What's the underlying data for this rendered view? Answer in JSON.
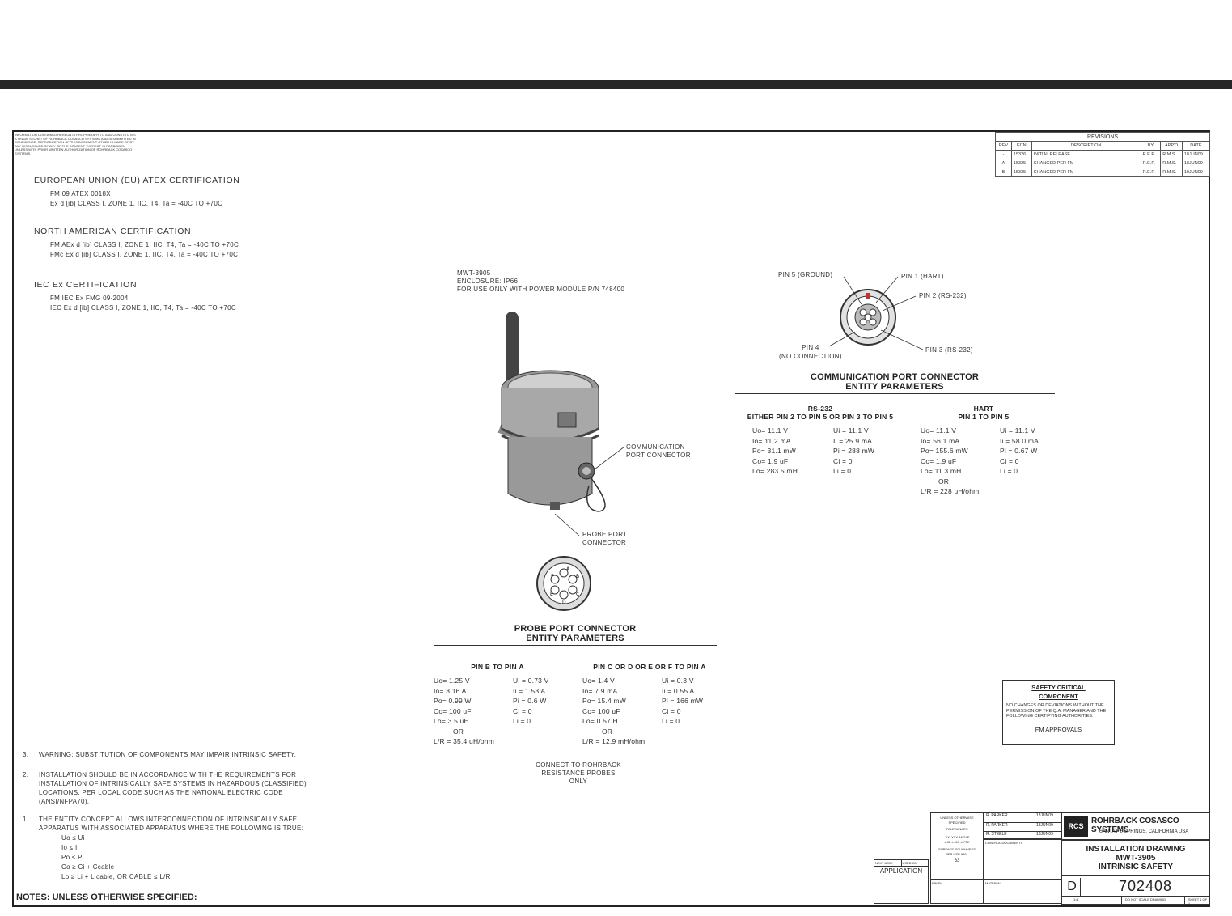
{
  "legal_text": "INFORMATION CONTAINED HEREON IS PROPRIETARY TO AND CONSTITUTES A TRADE SECRET OF ROHRBACK COSASCO SYSTEMS AND IS SUBMITTED IN CONFIDENCE. REPRODUCTION OF THIS DOCUMENT OTHER IS MADE OF BY ANY DISCLOSURE OF ANY OF THE CONTENT THEREOF IS FORBIDDEN UNLESS WITH PRIOR WRITTEN AUTHORIZATION OF ROHRBACK COSASCO SYSTEMS.",
  "certifications": [
    {
      "heading": "EUROPEAN UNION (EU) ATEX CERTIFICATION",
      "lines": [
        "FM 09 ATEX 0018X",
        "Ex d [ib] CLASS I, ZONE 1, IIC, T4, Ta = -40C TO +70C"
      ]
    },
    {
      "heading": "NORTH AMERICAN CERTIFICATION",
      "lines": [
        "FM AEx d [ib] CLASS I, ZONE 1, IIC, T4, Ta = -40C TO +70C",
        "FMc Ex d [ib] CLASS I, ZONE 1, IIC, T4, Ta = -40C TO +70C"
      ]
    },
    {
      "heading": "IEC Ex CERTIFICATION",
      "lines": [
        "FM IEC Ex FMG 09-2004",
        "IEC Ex d [ib] CLASS I, ZONE 1, IIC, T4, Ta = -40C TO +70C"
      ]
    }
  ],
  "revisions": {
    "title": "REVISIONS",
    "headers": [
      "REV",
      "ECN",
      "DESCRIPTION",
      "BY",
      "APP'D",
      "DATE"
    ],
    "rows": [
      [
        "-",
        "15326",
        "INITIAL RELEASE",
        "R.E.P.",
        "R.M.S.",
        "18JUN09"
      ],
      [
        "A",
        "15325",
        "CHANGED PER FM",
        "R.E.P.",
        "R.M.S.",
        "18JUN09"
      ],
      [
        "B",
        "15335",
        "CHANGED PER FM",
        "R.E.P.",
        "R.M.S.",
        "19JUN09"
      ]
    ]
  },
  "device_label": [
    "MWT-3905",
    "ENCLOSURE: IP66",
    "FOR USE ONLY WITH POWER MODULE P/N 748400"
  ],
  "callouts": {
    "comm_port": [
      "COMMUNICATION",
      "PORT CONNECTOR"
    ],
    "probe_port": [
      "PROBE PORT",
      "CONNECTOR"
    ]
  },
  "comm_pins": {
    "pin5": "PIN 5 (GROUND)",
    "pin1": "PIN 1 (HART)",
    "pin2": "PIN 2 (RS-232)",
    "pin3": "PIN 3 (RS-232)",
    "pin4": [
      "PIN 4",
      "(NO CONNECTION)"
    ]
  },
  "comm_section": {
    "title": [
      "COMMUNICATION PORT CONNECTOR",
      "ENTITY PARAMETERS"
    ],
    "rs232": {
      "heading": [
        "RS-232",
        "EITHER PIN 2 TO PIN 5 OR PIN 3 TO PIN 5"
      ],
      "left": [
        "Uo= 11.1 V",
        "Io= 11.2 mA",
        "Po= 31.1 mW",
        "Co= 1.9 uF",
        "Lo= 283.5 mH"
      ],
      "right": [
        "Ui = 11.1 V",
        "Ii = 25.9 mA",
        "Pi = 288 mW",
        "Ci = 0",
        "Li = 0"
      ]
    },
    "hart": {
      "heading": [
        "HART",
        "PIN 1 TO PIN 5"
      ],
      "left": [
        "Uo= 11.1 V",
        "Io= 56.1 mA",
        "Po= 155.6 mW",
        "Co= 1.9 uF",
        "Lo= 11.3 mH"
      ],
      "right": [
        "Ui = 11.1 V",
        "Ii = 58.0 mA",
        "Pi = 0.67 W",
        "Ci = 0",
        "Li = 0"
      ],
      "or": "OR",
      "ratio": "L/R = 228 uH/ohm"
    }
  },
  "probe_pin_letters": [
    "A",
    "B",
    "C",
    "D",
    "E",
    "F"
  ],
  "probe_section": {
    "title": [
      "PROBE PORT CONNECTOR",
      "ENTITY PARAMETERS"
    ],
    "ba": {
      "heading": "PIN B TO PIN A",
      "left": [
        "Uo= 1.25 V",
        "Io= 3.16 A",
        "Po= 0.99 W",
        "Co= 100 uF",
        "Lo= 3.5 uH"
      ],
      "right": [
        "Ui = 0.73 V",
        "Ii = 1.53 A",
        "Pi = 0.6 W",
        "Ci = 0",
        "Li = 0"
      ],
      "or": "OR",
      "ratio": "L/R = 35.4 uH/ohm"
    },
    "cf": {
      "heading": "PIN C OR D OR E OR F TO PIN A",
      "left": [
        "Uo= 1.4 V",
        "Io= 7.9 mA",
        "Po= 15.4 mW",
        "Co= 100 uF",
        "Lo= 0.57 H"
      ],
      "right": [
        "Ui = 0.3 V",
        "Ii = 0.55 A",
        "Pi = 166 mW",
        "Ci = 0",
        "Li = 0"
      ],
      "or": "OR",
      "ratio": "L/R = 12.9 mH/ohm"
    },
    "connect_note": [
      "CONNECT TO ROHRBACK",
      "RESISTANCE PROBES",
      "ONLY"
    ]
  },
  "safety_box": {
    "title": [
      "SAFETY CRITICAL",
      "COMPONENT"
    ],
    "body": "NO CHANGES OR DEVIATIONS WITHOUT THE PERMISSION OF THE Q.A. MANAGER AND THE FOLLOWING CERTIFYING AUTHORITIES:",
    "authority": "FM APPROVALS"
  },
  "notes": {
    "n3": [
      "3.",
      "WARNING: SUBSTITUTION OF COMPONENTS MAY IMPAIR INTRINSIC SAFETY."
    ],
    "n2": [
      "2.",
      "INSTALLATION SHOULD BE IN ACCORDANCE WITH THE REQUIREMENTS FOR",
      "INSTALLATION OF INTRINSICALLY SAFE SYSTEMS IN HAZARDOUS (CLASSIFIED)",
      "LOCATIONS, PER LOCAL CODE SUCH AS THE NATIONAL ELECTRIC CODE",
      "(ANSI/NFPA70)."
    ],
    "n1": [
      "1.",
      "THE ENTITY CONCEPT ALLOWS INTERCONNECTION OF INTRINSICALLY SAFE",
      "APPARATUS WITH ASSOCIATED APPARATUS WHERE THE FOLLOWING IS TRUE:"
    ],
    "conditions": [
      "Uo  ≤  Ui",
      "Io  ≤  Ii",
      "Po  ≤  Pi",
      "Co  ≥  Ci + Ccable",
      "Lo  ≥  Li + L cable, OR CABLE ≤ L/R"
    ],
    "footer": "NOTES: UNLESS OTHERWISE SPECIFIED:"
  },
  "title_block": {
    "company": "ROHRBACK COSASCO SYSTEMS",
    "location": "SANTA FE SPRINGS, CALIFORNIA USA",
    "title": [
      "INSTALLATION DRAWING",
      "MWT-3905",
      "INTRINSIC SAFETY"
    ],
    "size": "D",
    "dwg_no": "702408",
    "application": "APPLICATION",
    "next_assy": "NEXT ASSY",
    "used_on": "USED ON",
    "tolerance": [
      "UNLESS OTHERWISE",
      "SPECIFIED",
      "TOLERANCES",
      ".XX  .XXX  ANGLE",
      "±.02 ±.010 ±0°30'"
    ],
    "surface": [
      "SURFACE ROUGHNESS",
      "PER USB 9461"
    ],
    "roughness": "63",
    "drawn": "R. PARKER",
    "checked": "R. PARKER",
    "approved": "R. STEELE",
    "dates": [
      "18JUN09",
      "18JUN09",
      "18JUN09"
    ],
    "contract": "CONTROL DOCUMENTS",
    "material": "MATERIAL",
    "finish": "FINISH",
    "scale": "1=1",
    "do_not_scale": "DO NOT SCALE DRAWING",
    "sheet": "SHEET 1 OF 1"
  }
}
